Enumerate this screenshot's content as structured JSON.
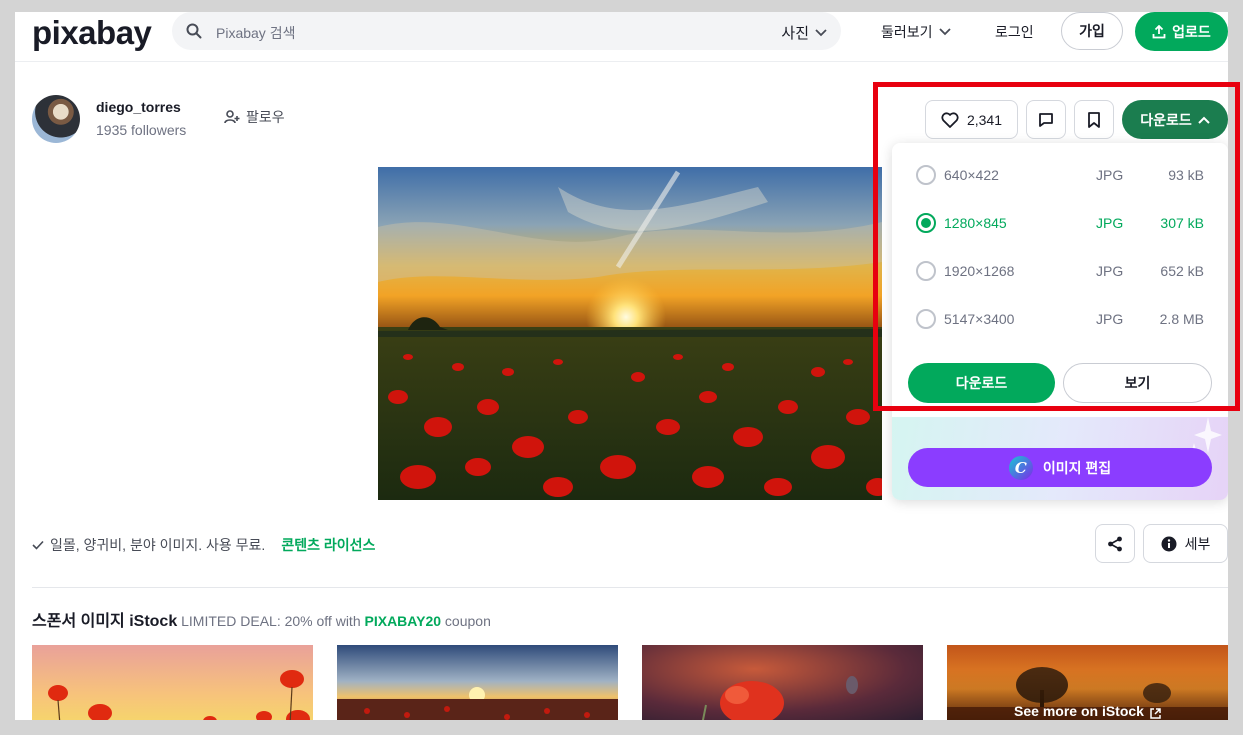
{
  "header": {
    "logo": "pixabay",
    "search_placeholder": "Pixabay 검색",
    "search_type": "사진",
    "explore": "둘러보기",
    "login": "로그인",
    "join": "가입",
    "upload": "업로드"
  },
  "author": {
    "name": "diego_torres",
    "followers": "1935 followers",
    "follow": "팔로우"
  },
  "actions": {
    "likes": "2,341",
    "download": "다운로드"
  },
  "download_options": [
    {
      "resolution": "640×422",
      "format": "JPG",
      "size": "93 kB",
      "selected": false
    },
    {
      "resolution": "1280×845",
      "format": "JPG",
      "size": "307 kB",
      "selected": true
    },
    {
      "resolution": "1920×1268",
      "format": "JPG",
      "size": "652 kB",
      "selected": false
    },
    {
      "resolution": "5147×3400",
      "format": "JPG",
      "size": "2.8 MB",
      "selected": false
    }
  ],
  "dropdown": {
    "download": "다운로드",
    "view": "보기",
    "edit_image": "이미지 편집",
    "canva_letter": "C"
  },
  "license": {
    "text": "일몰, 양귀비, 분야 이미지. 사용 무료.",
    "link": "콘텐츠 라이선스"
  },
  "details": "세부",
  "sponsor": {
    "title": "스폰서 이미지 iStock",
    "deal": "LIMITED DEAL: 20% off with",
    "code": "PIXABAY20",
    "suffix": "coupon",
    "see_more": "See more on iStock"
  },
  "colors": {
    "brand_green": "#02a95c",
    "download_dark_green": "#1b7d4f",
    "canva_purple": "#8b3dff",
    "highlight_red": "#e8000f"
  }
}
